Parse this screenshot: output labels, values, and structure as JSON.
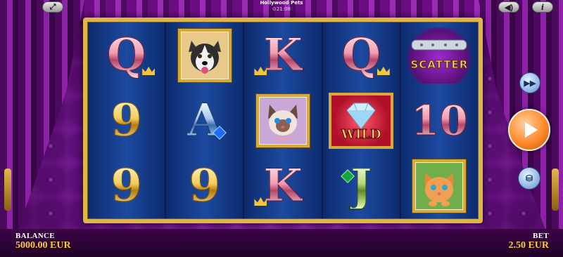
{
  "game": {
    "title": "Hollywood Pets",
    "clock": "⊙21:08"
  },
  "topbar": {
    "fullscreen_icon": "expand-icon",
    "sound_icon": "speaker-icon",
    "info_label": "i"
  },
  "reels": [
    [
      "Q",
      "husky-portrait",
      "9"
    ],
    [
      "9",
      "A",
      "9"
    ],
    [
      "K",
      "cat-portrait",
      "K"
    ],
    [
      "Q",
      "WILD",
      "J"
    ],
    [
      "SCATTER",
      "10",
      "kitten-portrait"
    ]
  ],
  "symbols": {
    "wild_label": "WILD",
    "scatter_label": "SCATTER"
  },
  "controls": {
    "fast_forward_icon": "fast-forward-icon",
    "spin_icon": "play-icon",
    "bet_icon": "coins-icon"
  },
  "footer": {
    "balance_label": "BALANCE",
    "balance_value": "5000.00 EUR",
    "bet_label": "BET",
    "bet_value": "2.50 EUR"
  },
  "colors": {
    "frame_gold": "#e0b548",
    "reel_blue": "#1c4aa0",
    "curtain_purple": "#8d22a8",
    "amount_gold": "#f3c84a",
    "spin_orange": "#ff8a2b"
  }
}
